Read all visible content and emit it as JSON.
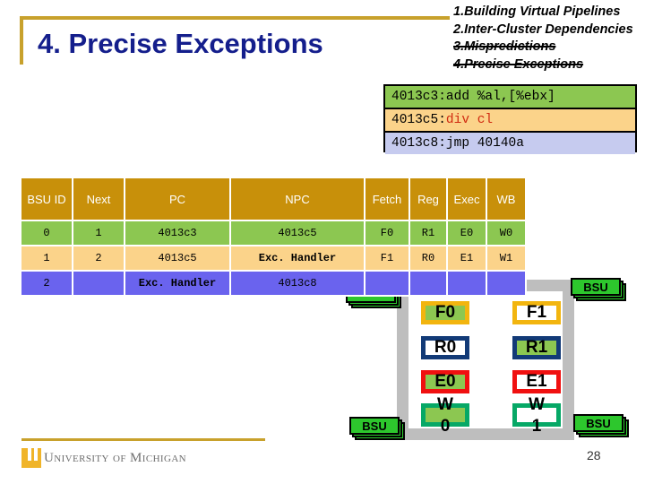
{
  "slide": {
    "title": "4. Precise Exceptions",
    "page_number": "28",
    "accent_color": "#C8A12C",
    "title_color": "#141E8C"
  },
  "agenda": {
    "items": [
      {
        "label": "1.Building Virtual Pipelines",
        "struck": false
      },
      {
        "label": "2.Inter-Cluster Dependencies",
        "struck": false
      },
      {
        "label": "3.Mispredictions",
        "struck": true
      },
      {
        "label": "4.Precise Exceptions",
        "struck": true
      }
    ]
  },
  "code_box": {
    "rows": [
      {
        "addr": "4013c3:",
        "text": "add %al,[%ebx]",
        "highlight": "",
        "bg": "#8CC751"
      },
      {
        "addr": "4013c5:",
        "text": "div cl",
        "highlight": "div cl",
        "bg": "#FBD38A"
      },
      {
        "addr": "4013c8:",
        "text": "jmp 40140a",
        "highlight": "",
        "bg": "#C6CBEF"
      }
    ]
  },
  "table": {
    "headers": [
      "BSU ID",
      "Next",
      "PC",
      "NPC",
      "Fetch",
      "Reg",
      "Exec",
      "WB"
    ],
    "header_bg": "#C8900A",
    "rows": [
      {
        "bg": "#8CC751",
        "cells": [
          "0",
          "1",
          "4013c3",
          "4013c5",
          "F0",
          "R1",
          "E0",
          "W0"
        ]
      },
      {
        "bg": "#FBD38A",
        "cells": [
          "1",
          "2",
          "4013c5",
          "Exc. Handler",
          "F1",
          "R0",
          "E1",
          "W1"
        ]
      },
      {
        "bg": "#6A63EE",
        "cells": [
          "2",
          "",
          "Exc. Handler",
          "4013c8",
          "",
          "",
          "",
          ""
        ]
      }
    ]
  },
  "pipeline": {
    "column_left": [
      {
        "label": "F0",
        "border": "#F2B50F",
        "fill": "#8CC751"
      },
      {
        "label": "R0",
        "border": "#123A77",
        "fill": "#FFFFFF"
      },
      {
        "label": "E0",
        "border": "#F01010",
        "fill": "#8CC751"
      },
      {
        "label": "W0",
        "border": "#06A866",
        "fill": "#8CC751",
        "over_top": "W",
        "over_bottom": "0"
      }
    ],
    "column_right": [
      {
        "label": "F1",
        "border": "#F2B50F",
        "fill": "#FFFFFF"
      },
      {
        "label": "R1",
        "border": "#123A77",
        "fill": "#8CC751"
      },
      {
        "label": "E1",
        "border": "#F01010",
        "fill": "#FFFFFF"
      },
      {
        "label": "W1",
        "border": "#06A866",
        "fill": "#FFFFFF",
        "over_top": "W",
        "over_bottom": "1"
      }
    ]
  },
  "bsu_icons": [
    {
      "label": "BSU"
    },
    {
      "label": "BSU"
    },
    {
      "label": "BSU"
    },
    {
      "label": ""
    }
  ],
  "footer": {
    "logo_text": "University of Michigan"
  }
}
